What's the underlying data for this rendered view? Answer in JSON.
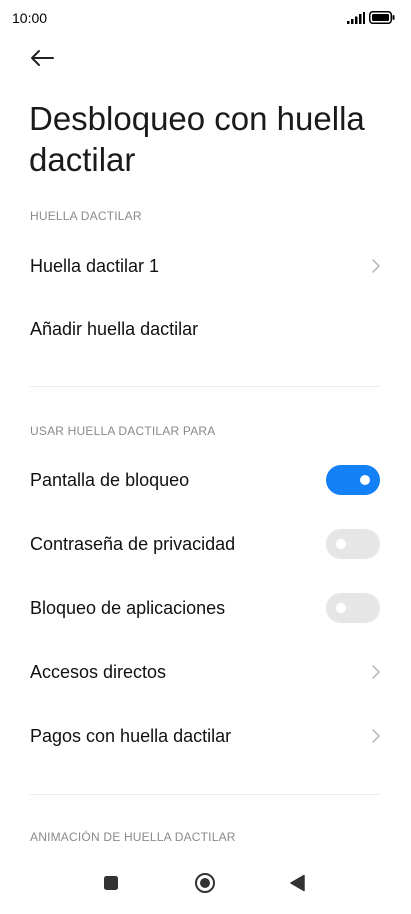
{
  "status_bar": {
    "time": "10:00",
    "signal_icon": "signal-icon",
    "battery_icon": "battery-icon"
  },
  "header": {
    "back_icon": "arrow-left-icon",
    "title": "Desbloqueo con huella dactilar"
  },
  "section_fingerprints": {
    "header": "HUELLA DACTILAR",
    "items": [
      {
        "label": "Huella dactilar 1",
        "type": "chevron"
      },
      {
        "label": "Añadir huella dactilar",
        "type": "none"
      }
    ]
  },
  "section_use_for": {
    "header": "USAR HUELLA DACTILAR PARA",
    "items": [
      {
        "label": "Pantalla de bloqueo",
        "type": "toggle",
        "state": "on"
      },
      {
        "label": "Contraseña de privacidad",
        "type": "toggle",
        "state": "off"
      },
      {
        "label": "Bloqueo de aplicaciones",
        "type": "toggle",
        "state": "off"
      },
      {
        "label": "Accesos directos",
        "type": "chevron"
      },
      {
        "label": "Pagos con huella dactilar",
        "type": "chevron"
      }
    ]
  },
  "section_animation": {
    "header": "ANIMACIÓN DE HUELLA DACTILAR"
  },
  "nav_bar": {
    "recents_icon": "square-icon",
    "home_icon": "circle-home-icon",
    "back_icon": "triangle-back-icon"
  },
  "colors": {
    "accent": "#1480f5",
    "toggle_off": "#e6e6e6",
    "section_header": "#8a8a8a"
  }
}
